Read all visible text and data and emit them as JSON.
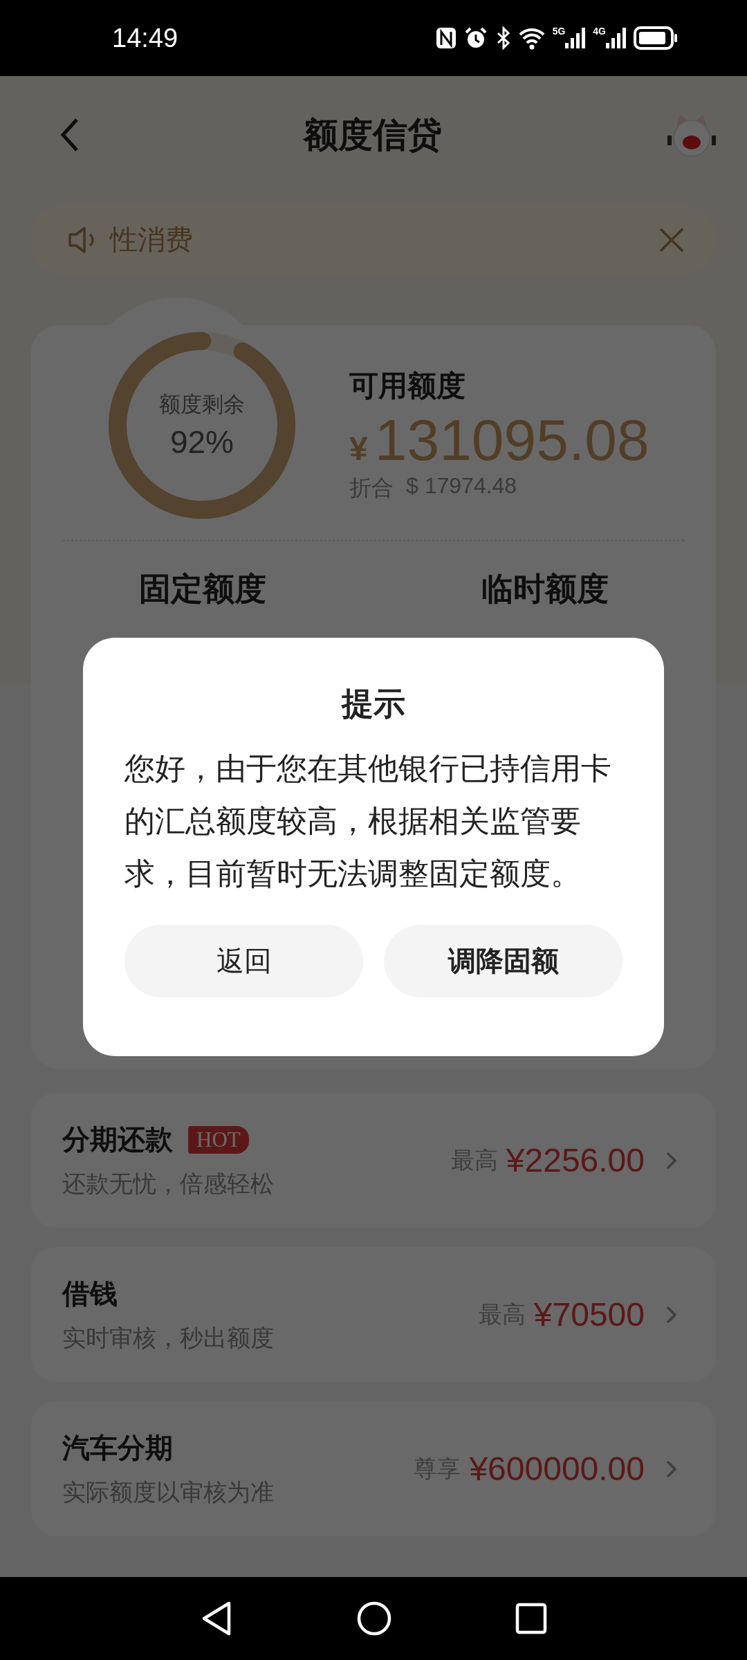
{
  "status_bar": {
    "time": "14:49",
    "networks": [
      "5G",
      "4G"
    ]
  },
  "header": {
    "title": "额度信贷"
  },
  "notice": {
    "text": "性消费"
  },
  "quota": {
    "ring": {
      "label": "额度剩余",
      "value": "92%"
    },
    "available_label": "可用额度",
    "currency": "¥",
    "amount": "131095.08",
    "converted_label": "折合",
    "converted": "$ 17974.48",
    "columns": [
      "固定额度",
      "临时额度"
    ]
  },
  "products": [
    {
      "title": "分期还款",
      "badge": "HOT",
      "subtitle": "还款无忧，倍感轻松",
      "prefix": "最高",
      "price": "¥2256.00"
    },
    {
      "title": "借钱",
      "subtitle": "实时审核，秒出额度",
      "prefix": "最高",
      "price": "¥70500"
    },
    {
      "title": "汽车分期",
      "subtitle": "实际额度以审核为准",
      "prefix": "尊享",
      "price": "¥600000.00"
    }
  ],
  "dialog": {
    "title": "提示",
    "message": "您好，由于您在其他银行已持信用卡的汇总额度较高，根据相关监管要求，目前暂时无法调整固定额度。",
    "buttons": [
      {
        "label": "返回",
        "primary": false
      },
      {
        "label": "调降固额",
        "primary": true
      }
    ]
  }
}
